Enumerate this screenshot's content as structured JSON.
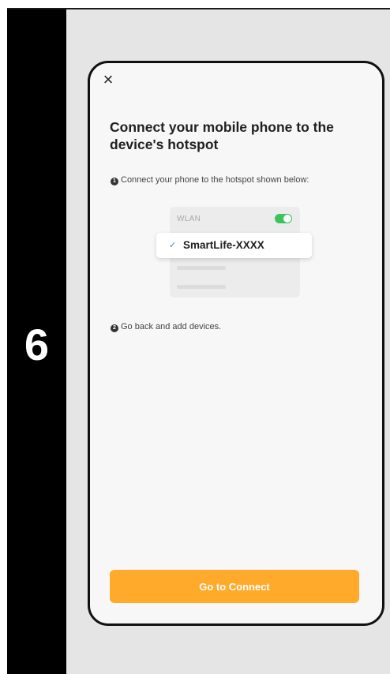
{
  "step": {
    "number": "6"
  },
  "screen": {
    "close_glyph": "×",
    "title": "Connect your mobile phone to the device's hotspot",
    "instructions": [
      {
        "bullet": "1",
        "text": "Connect your phone to the hotspot shown below:"
      },
      {
        "bullet": "2",
        "text": "Go back and add devices."
      }
    ],
    "wifi_card": {
      "label": "WLAN",
      "toggle_on": true,
      "selected_network": {
        "check_glyph": "✓",
        "name": "SmartLife-XXXX"
      }
    },
    "primary_button": {
      "label": "Go to Connect"
    }
  },
  "colors": {
    "accent": "#ffaa2b",
    "toggle_on": "#3cc45c",
    "check": "#4a74e8",
    "step_column": "#000000",
    "background": "#e5e5e5"
  },
  "icons": {
    "close": "close-icon",
    "check": "check-icon",
    "toggle": "toggle-switch"
  }
}
